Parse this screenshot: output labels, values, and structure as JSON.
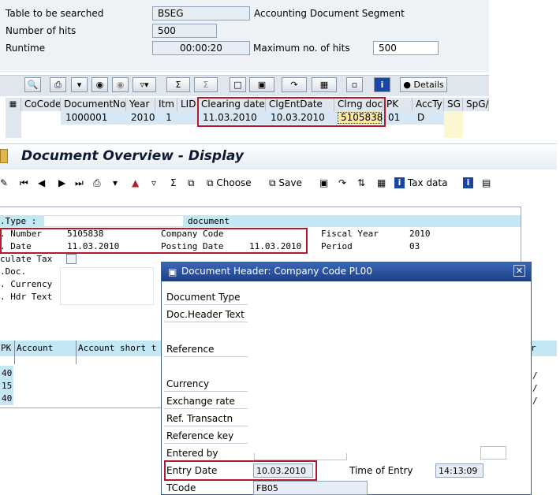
{
  "search": {
    "table_label": "Table to be searched",
    "table_value": "BSEG",
    "table_desc": "Accounting Document Segment",
    "hits_label": "Number of hits",
    "hits_value": "500",
    "runtime_label": "Runtime",
    "runtime_value": "00:00:20",
    "max_hits_label": "Maximum no. of hits",
    "max_hits_value": "500"
  },
  "toolbar1": {
    "details_label": "Details"
  },
  "grid": {
    "columns": [
      "CoCode",
      "DocumentNo",
      "Year",
      "Itm",
      "LID",
      "Clearing date",
      "ClgEntDate",
      "Clrng doc.",
      "PK",
      "AccTy",
      "SG",
      "SpG/L"
    ],
    "row": [
      "",
      "1000001",
      "2010",
      "1",
      "",
      "11.03.2010",
      "10.03.2010",
      "5105838",
      "01",
      "D",
      "",
      ""
    ]
  },
  "overview": {
    "title": "Document Overview - Display",
    "choose_label": "Choose",
    "save_label": "Save",
    "tax_label": "Tax data",
    "type_label": ".Type :",
    "type_value": "document",
    "number_label": ". Number",
    "number_value": "5105838",
    "cocode_label": "Company Code",
    "fiscal_label": "Fiscal Year",
    "fiscal_value": "2010",
    "date_label": ". Date",
    "date_value": "11.03.2010",
    "posting_label": "Posting Date",
    "posting_value": "11.03.2010",
    "period_label": "Period",
    "period_value": "03",
    "calc_tax_label": "culate Tax",
    "refdoc_label": ".Doc.",
    "currency_label": ". Currency",
    "hdr_label": ". Hdr Text",
    "col_pk": "PK",
    "col_account": "Account",
    "col_short": "Account short t",
    "pk_rows": [
      "40",
      "15",
      "40"
    ]
  },
  "dialog": {
    "title": "Document Header: Company Code PL00",
    "doc_type": "Document Type",
    "header_text": "Doc.Header Text",
    "reference": "Reference",
    "currency": "Currency",
    "exchange": "Exchange rate",
    "ref_trans": "Ref. Transactn",
    "ref_key": "Reference key",
    "entered_by": "Entered by",
    "entry_date": "Entry Date",
    "entry_date_value": "10.03.2010",
    "time_label": "Time of Entry",
    "time_value": "14:13:09",
    "tcode": "TCode",
    "tcode_value": "FB05"
  }
}
